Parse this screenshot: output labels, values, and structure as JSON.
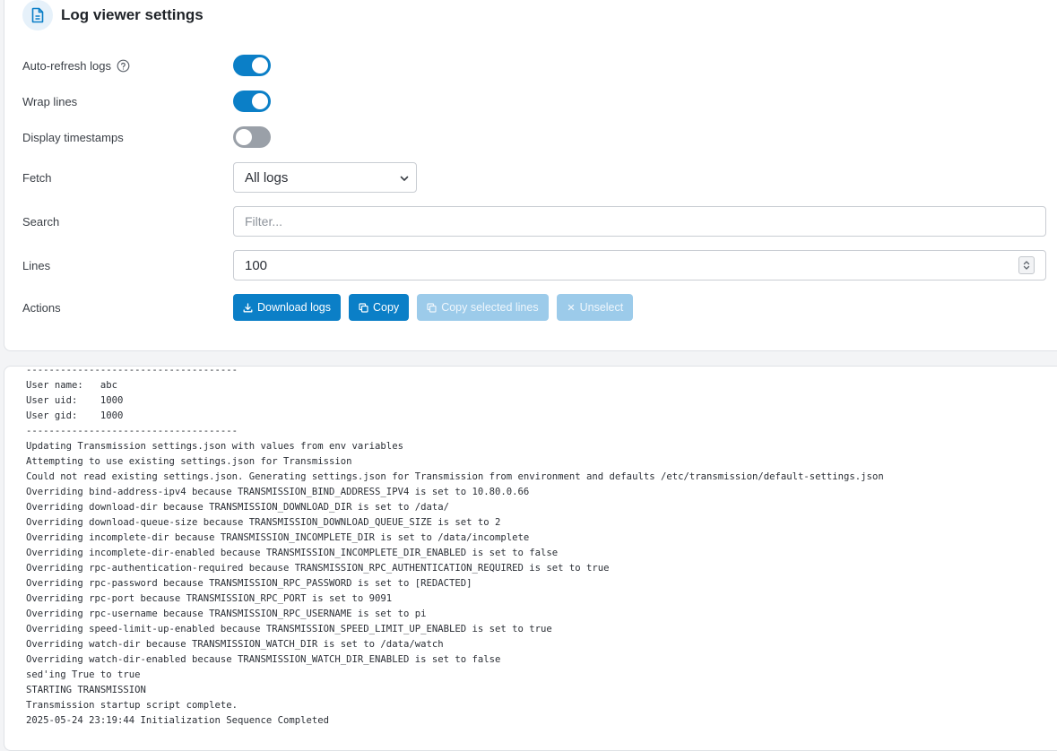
{
  "header": {
    "title": "Log viewer settings",
    "icon": "file-icon"
  },
  "settings": {
    "auto_refresh": {
      "label": "Auto-refresh logs",
      "enabled": true
    },
    "wrap_lines": {
      "label": "Wrap lines",
      "enabled": true
    },
    "display_timestamps": {
      "label": "Display timestamps",
      "enabled": false
    },
    "fetch": {
      "label": "Fetch",
      "value": "All logs"
    },
    "search": {
      "label": "Search",
      "placeholder": "Filter...",
      "value": ""
    },
    "lines": {
      "label": "Lines",
      "value": "100"
    },
    "actions": {
      "label": "Actions",
      "download": "Download logs",
      "copy": "Copy",
      "copy_selected": "Copy selected lines",
      "unselect": "Unselect"
    }
  },
  "colors": {
    "accent": "#0b7fc7",
    "accent_disabled": "#9ccbea",
    "toggle_off": "#9aa0a8"
  },
  "log_lines": [
    "-------------------------------------",
    "User name:   abc",
    "User uid:    1000",
    "User gid:    1000",
    "-------------------------------------",
    "Updating Transmission settings.json with values from env variables",
    "Attempting to use existing settings.json for Transmission",
    "Could not read existing settings.json. Generating settings.json for Transmission from environment and defaults /etc/transmission/default-settings.json",
    "Overriding bind-address-ipv4 because TRANSMISSION_BIND_ADDRESS_IPV4 is set to 10.80.0.66",
    "Overriding download-dir because TRANSMISSION_DOWNLOAD_DIR is set to /data/",
    "Overriding download-queue-size because TRANSMISSION_DOWNLOAD_QUEUE_SIZE is set to 2",
    "Overriding incomplete-dir because TRANSMISSION_INCOMPLETE_DIR is set to /data/incomplete",
    "Overriding incomplete-dir-enabled because TRANSMISSION_INCOMPLETE_DIR_ENABLED is set to false",
    "Overriding rpc-authentication-required because TRANSMISSION_RPC_AUTHENTICATION_REQUIRED is set to true",
    "Overriding rpc-password because TRANSMISSION_RPC_PASSWORD is set to [REDACTED]",
    "Overriding rpc-port because TRANSMISSION_RPC_PORT is set to 9091",
    "Overriding rpc-username because TRANSMISSION_RPC_USERNAME is set to pi",
    "Overriding speed-limit-up-enabled because TRANSMISSION_SPEED_LIMIT_UP_ENABLED is set to true",
    "Overriding watch-dir because TRANSMISSION_WATCH_DIR is set to /data/watch",
    "Overriding watch-dir-enabled because TRANSMISSION_WATCH_DIR_ENABLED is set to false",
    "sed'ing True to true",
    "STARTING TRANSMISSION",
    "Transmission startup script complete.",
    "2025-05-24 23:19:44 Initialization Sequence Completed"
  ]
}
